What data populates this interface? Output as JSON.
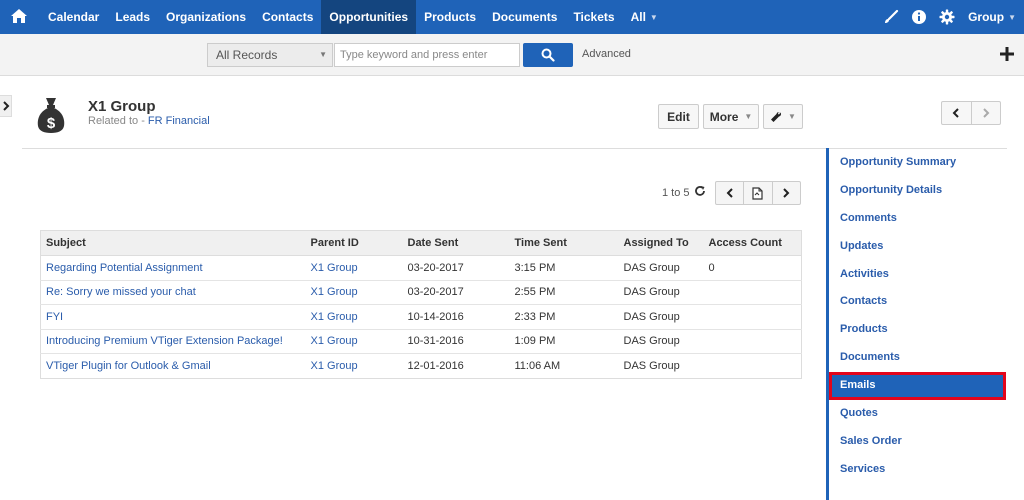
{
  "nav": {
    "items": [
      {
        "label": "Calendar",
        "active": false
      },
      {
        "label": "Leads",
        "active": false
      },
      {
        "label": "Organizations",
        "active": false
      },
      {
        "label": "Contacts",
        "active": false
      },
      {
        "label": "Opportunities",
        "active": true
      },
      {
        "label": "Products",
        "active": false
      },
      {
        "label": "Documents",
        "active": false
      },
      {
        "label": "Tickets",
        "active": false
      }
    ],
    "all_label": "All",
    "user_label": "Group"
  },
  "search": {
    "records_select": "All Records",
    "placeholder": "Type keyword and press enter",
    "advanced_label": "Advanced"
  },
  "record": {
    "title": "X1 Group",
    "related_prefix": "Related to - ",
    "related_link": "FR Financial",
    "edit_label": "Edit",
    "more_label": "More"
  },
  "pagination": {
    "info": "1 to 5"
  },
  "table": {
    "headers": [
      "Subject",
      "Parent ID",
      "Date Sent",
      "Time Sent",
      "Assigned To",
      "Access Count"
    ],
    "rows": [
      [
        "Regarding Potential Assignment",
        "X1 Group",
        "03-20-2017",
        "3:15 PM",
        "DAS Group",
        "0"
      ],
      [
        "Re: Sorry we missed your chat",
        "X1 Group",
        "03-20-2017",
        "2:55 PM",
        "DAS Group",
        ""
      ],
      [
        "FYI",
        "X1 Group",
        "10-14-2016",
        "2:33 PM",
        "DAS Group",
        ""
      ],
      [
        "Introducing Premium VTiger Extension Package!",
        "X1 Group",
        "10-31-2016",
        "1:09 PM",
        "DAS Group",
        ""
      ],
      [
        "VTiger Plugin for Outlook & Gmail",
        "X1 Group",
        "12-01-2016",
        "11:06 AM",
        "DAS Group",
        ""
      ]
    ]
  },
  "sidebar": {
    "items": [
      {
        "label": "Opportunity Summary",
        "active": false
      },
      {
        "label": "Opportunity Details",
        "active": false
      },
      {
        "label": "Comments",
        "active": false
      },
      {
        "label": "Updates",
        "active": false
      },
      {
        "label": "Activities",
        "active": false
      },
      {
        "label": "Contacts",
        "active": false
      },
      {
        "label": "Products",
        "active": false
      },
      {
        "label": "Documents",
        "active": false
      },
      {
        "label": "Emails",
        "active": true
      },
      {
        "label": "Quotes",
        "active": false
      },
      {
        "label": "Sales Order",
        "active": false
      },
      {
        "label": "Services",
        "active": false
      }
    ]
  },
  "colors": {
    "brand_blue": "#1f63b8",
    "active_nav": "#14457f",
    "link_blue": "#2a5cab",
    "highlight_red": "#e3051b"
  }
}
